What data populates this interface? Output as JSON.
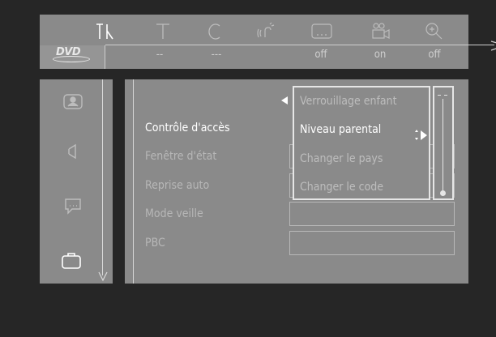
{
  "toolbar": {
    "icons": [
      "setup-tools-icon",
      "text-icon",
      "clock-icon",
      "sound-icon",
      "subtitle-icon",
      "camera-angle-icon",
      "zoom-icon"
    ],
    "values": [
      "--",
      "---",
      "off",
      "on",
      "off"
    ],
    "logo": "DVD"
  },
  "sidebar": {
    "icons": [
      "picture-icon",
      "speaker-icon",
      "speech-icon",
      "briefcase-icon"
    ]
  },
  "menu": {
    "items": [
      "Contrôle d'accès",
      "Fenêtre d'état",
      "Reprise auto",
      "Mode veille",
      "PBC"
    ],
    "selected": "Contrôle d'accès"
  },
  "submenu": {
    "items": [
      "Verrouillage enfant",
      "Niveau parental",
      "Changer le pays",
      "Changer le code"
    ],
    "selected": "Niveau parental"
  }
}
